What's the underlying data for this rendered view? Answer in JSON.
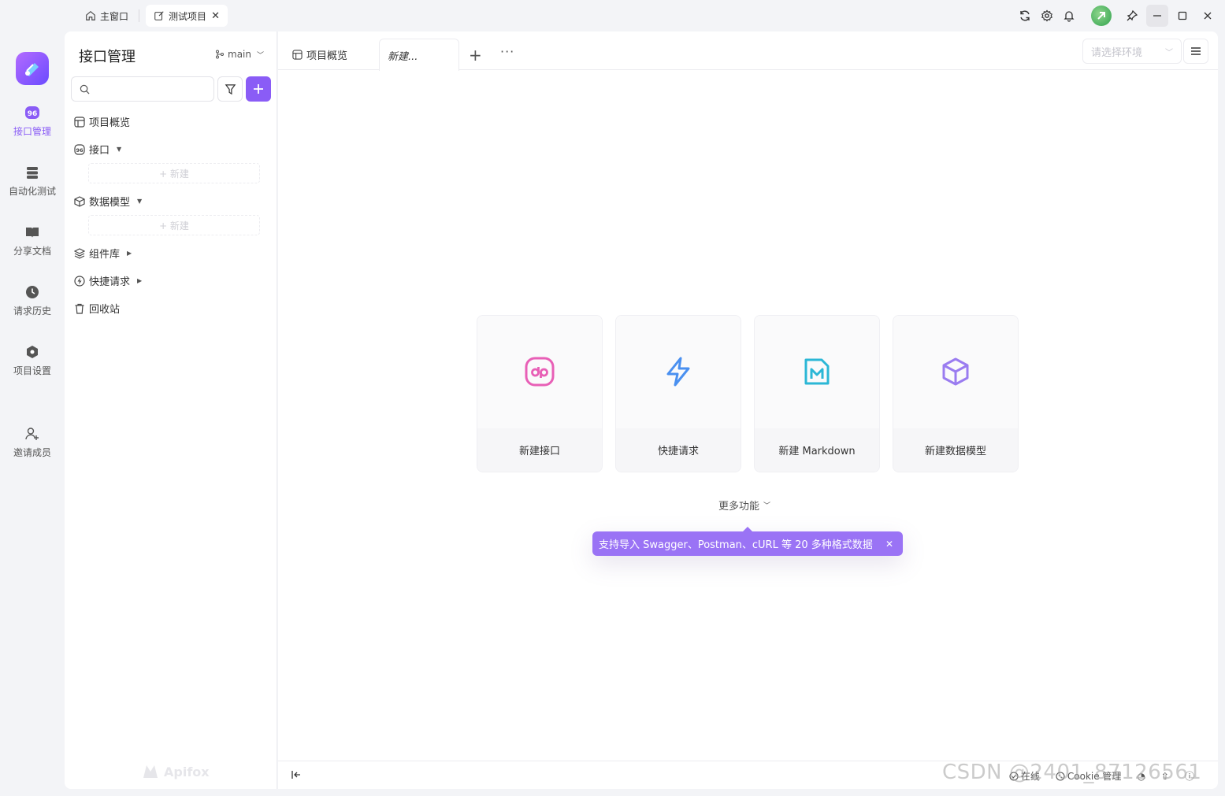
{
  "window": {
    "tabs": [
      {
        "label": "主窗口"
      },
      {
        "label": "测试项目"
      }
    ]
  },
  "leftnav": {
    "items": [
      {
        "label": "接口管理"
      },
      {
        "label": "自动化测试"
      },
      {
        "label": "分享文档"
      },
      {
        "label": "请求历史"
      },
      {
        "label": "项目设置"
      },
      {
        "label": "邀请成员"
      }
    ]
  },
  "sidebar": {
    "title": "接口管理",
    "branch": "main",
    "search_placeholder": "",
    "tree": [
      {
        "label": "项目概览"
      },
      {
        "label": "接口"
      },
      {
        "label": "数据模型"
      },
      {
        "label": "组件库"
      },
      {
        "label": "快捷请求"
      },
      {
        "label": "回收站"
      }
    ],
    "new_label": "+ 新建",
    "brand": "Apifox"
  },
  "main": {
    "tabs": [
      {
        "label": "项目概览"
      },
      {
        "label": "新建..."
      }
    ],
    "env_placeholder": "请选择环境",
    "cards": [
      {
        "label": "新建接口",
        "icon": "api-icon",
        "color": "#e85fb6"
      },
      {
        "label": "快捷请求",
        "icon": "lightning-icon",
        "color": "#4a90f0"
      },
      {
        "label": "新建 Markdown",
        "icon": "markdown-icon",
        "color": "#2bb7d6"
      },
      {
        "label": "新建数据模型",
        "icon": "cube-icon",
        "color": "#9a7cf0"
      }
    ],
    "more": "更多功能",
    "tooltip": "支持导入 Swagger、Postman、cURL 等 20 多种格式数据",
    "footer": {
      "online": "在线",
      "cookie": "Cookie 管理"
    }
  },
  "watermark": "CSDN @2401_87126561",
  "colors": {
    "accent": "#8a5cf6",
    "tooltip": "#9a73f5"
  }
}
